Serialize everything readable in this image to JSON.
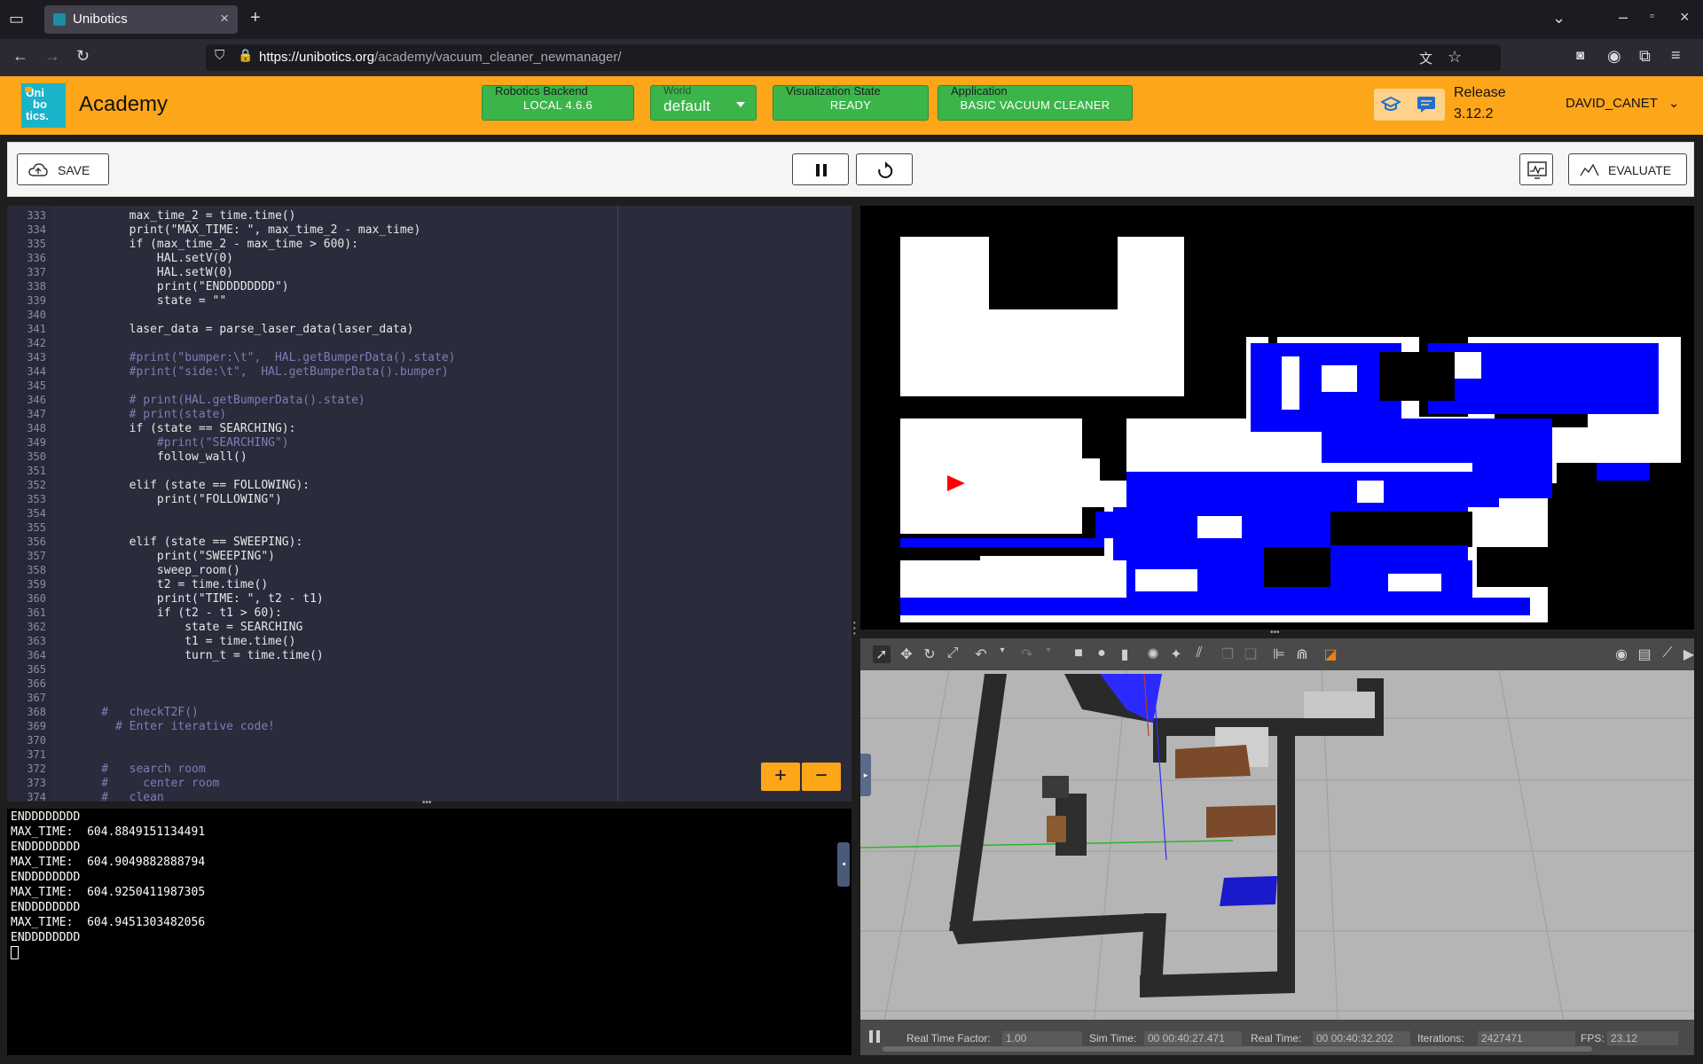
{
  "browser": {
    "tab_title": "Unibotics",
    "url_host": "https://unibotics.org",
    "url_path": "/academy/vacuum_cleaner_newmanager/"
  },
  "header": {
    "logo_text": [
      "Uni",
      "bo",
      "tics."
    ],
    "title": "Academy",
    "backend": {
      "label": "Robotics Backend",
      "value": "LOCAL 4.6.6"
    },
    "world": {
      "label": "World",
      "value": "default"
    },
    "visualization": {
      "label": "Visualization State",
      "value": "READY"
    },
    "application": {
      "label": "Application",
      "value": "BASIC VACUUM CLEANER"
    },
    "release_label": "Release",
    "release_version": "3.12.2",
    "user": "DAVID_CANET"
  },
  "toolbar": {
    "save_label": "SAVE",
    "evaluate_label": "EVALUATE"
  },
  "editor": {
    "lines": [
      {
        "n": "333",
        "code": "        max_time_2 = time.time()"
      },
      {
        "n": "334",
        "code": "        print(\"MAX_TIME: \", max_time_2 - max_time)"
      },
      {
        "n": "335",
        "code": "        if (max_time_2 - max_time > 600):"
      },
      {
        "n": "336",
        "code": "            HAL.setV(0)"
      },
      {
        "n": "337",
        "code": "            HAL.setW(0)"
      },
      {
        "n": "338",
        "code": "            print(\"ENDDDDDDDD\")"
      },
      {
        "n": "339",
        "code": "            state = \"\""
      },
      {
        "n": "340",
        "code": ""
      },
      {
        "n": "341",
        "code": "        laser_data = parse_laser_data(laser_data)"
      },
      {
        "n": "342",
        "code": ""
      },
      {
        "n": "343",
        "code": "        #print(\"bumper:\\t\",  HAL.getBumperData().state)"
      },
      {
        "n": "344",
        "code": "        #print(\"side:\\t\",  HAL.getBumperData().bumper)"
      },
      {
        "n": "345",
        "code": ""
      },
      {
        "n": "346",
        "code": "        # print(HAL.getBumperData().state)"
      },
      {
        "n": "347",
        "code": "        # print(state)"
      },
      {
        "n": "348",
        "code": "        if (state == SEARCHING):"
      },
      {
        "n": "349",
        "code": "            #print(\"SEARCHING\")"
      },
      {
        "n": "350",
        "code": "            follow_wall()"
      },
      {
        "n": "351",
        "code": ""
      },
      {
        "n": "352",
        "code": "        elif (state == FOLLOWING):"
      },
      {
        "n": "353",
        "code": "            print(\"FOLLOWING\")"
      },
      {
        "n": "354",
        "code": ""
      },
      {
        "n": "355",
        "code": ""
      },
      {
        "n": "356",
        "code": "        elif (state == SWEEPING):"
      },
      {
        "n": "357",
        "code": "            print(\"SWEEPING\")"
      },
      {
        "n": "358",
        "code": "            sweep_room()"
      },
      {
        "n": "359",
        "code": "            t2 = time.time()"
      },
      {
        "n": "360",
        "code": "            print(\"TIME: \", t2 - t1)"
      },
      {
        "n": "361",
        "code": "            if (t2 - t1 > 60):"
      },
      {
        "n": "362",
        "code": "                state = SEARCHING"
      },
      {
        "n": "363",
        "code": "                t1 = time.time()"
      },
      {
        "n": "364",
        "code": "                turn_t = time.time()"
      },
      {
        "n": "365",
        "code": ""
      },
      {
        "n": "366",
        "code": ""
      },
      {
        "n": "367",
        "code": ""
      },
      {
        "n": "368",
        "code": "    #   checkT2F()"
      },
      {
        "n": "369",
        "code": "      # Enter iterative code!"
      },
      {
        "n": "370",
        "code": ""
      },
      {
        "n": "371",
        "code": ""
      },
      {
        "n": "372",
        "code": "    #   search room"
      },
      {
        "n": "373",
        "code": "    #     center room"
      },
      {
        "n": "374",
        "code": "    #   clean"
      }
    ],
    "zoom_in": "+",
    "zoom_out": "−"
  },
  "console": {
    "lines": [
      "ENDDDDDDDD",
      "MAX_TIME:  604.8849151134491",
      "ENDDDDDDDD",
      "MAX_TIME:  604.9049882888794",
      "ENDDDDDDDD",
      "MAX_TIME:  604.9250411987305",
      "ENDDDDDDDD",
      "MAX_TIME:  604.9451303482056",
      "ENDDDDDDDD"
    ]
  },
  "gazebo": {
    "rtf_label": "Real Time Factor:",
    "rtf_value": "1.00",
    "sim_label": "Sim Time:",
    "sim_value": "00 00:40:27.471",
    "real_label": "Real Time:",
    "real_value": "00 00:40:32.202",
    "iter_label": "Iterations:",
    "iter_value": "2427471",
    "fps_label": "FPS:",
    "fps_value": "23.12"
  },
  "colors": {
    "accent": "#fda619",
    "status_green": "#3bb54a",
    "map_path": "#0000ff",
    "robot_marker": "#ff0000"
  }
}
